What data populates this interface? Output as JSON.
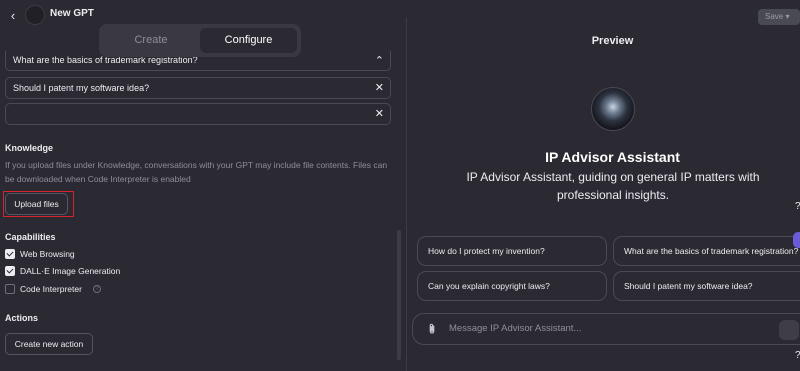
{
  "header": {
    "back_icon": "chevron-left-icon",
    "gpt_name": "New GPT",
    "save_label": "Save ▾"
  },
  "tabs": [
    {
      "label": "Create",
      "active": false
    },
    {
      "label": "Configure",
      "active": true
    }
  ],
  "conversation_starters": [
    {
      "text": "What are the basics of trademark registration?",
      "remove_icon": "chevron-up-icon",
      "remove_glyph": "⌃"
    },
    {
      "text": "Should I patent my software idea?",
      "remove_icon": "close-icon",
      "remove_glyph": "✕"
    },
    {
      "text": "",
      "remove_icon": "close-icon",
      "remove_glyph": "✕"
    }
  ],
  "knowledge": {
    "title": "Knowledge",
    "description": "If you upload files under Knowledge, conversations with your GPT may include file contents. Files can be downloaded when Code Interpreter is enabled",
    "upload_label": "Upload files"
  },
  "capabilities": {
    "title": "Capabilities",
    "items": [
      {
        "label": "Web Browsing",
        "checked": true
      },
      {
        "label": "DALL·E Image Generation",
        "checked": true
      },
      {
        "label": "Code Interpreter",
        "checked": false,
        "info_glyph": "?"
      }
    ]
  },
  "actions": {
    "title": "Actions",
    "new_action_label": "Create new action"
  },
  "preview": {
    "title": "Preview",
    "assistant_name": "IP Advisor Assistant",
    "assistant_description": "IP Advisor Assistant, guiding on general IP matters with professional insights.",
    "suggestions": [
      "How do I protect my invention?",
      "What are the basics of trademark registration?",
      "Can you explain copyright laws?",
      "Should I patent my software idea?"
    ],
    "composer_placeholder": "Message IP Advisor Assistant...",
    "attach_icon": "paperclip-icon",
    "edge_glyph_top": "?",
    "edge_glyph_bottom": "?"
  },
  "colors": {
    "background": "#2b2a33",
    "text": "#ececf1",
    "muted": "#8e8e9a",
    "highlight_box": "#d8232a",
    "accent": "#6b5bd6"
  }
}
